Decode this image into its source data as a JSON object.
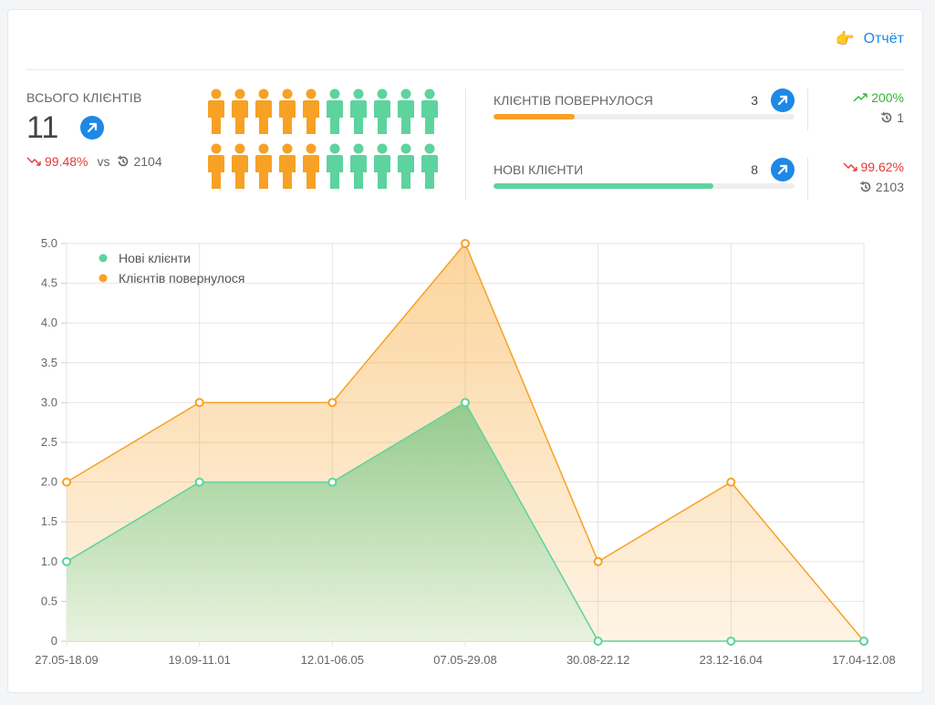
{
  "header": {
    "report_label": "Отчёт"
  },
  "summary": {
    "total_label": "ВСЬОГО КЛІЄНТІВ",
    "total_value": "11",
    "change_pct": "99.48%",
    "vs_label": "vs",
    "previous_value": "2104"
  },
  "people_grid": {
    "total": 20,
    "returned": 5,
    "colors": {
      "returned": "#f7a125",
      "new": "#5dd39e"
    }
  },
  "metrics": [
    {
      "label": "КЛІЄНТІВ ПОВЕРНУЛОСЯ",
      "value": "3",
      "fill_fraction": 0.27,
      "color": "#f7a125",
      "change_pct": "200%",
      "change_dir": "up",
      "previous_value": "1"
    },
    {
      "label": "НОВІ КЛІЄНТИ",
      "value": "8",
      "fill_fraction": 0.73,
      "color": "#5dd39e",
      "change_pct": "99.62%",
      "change_dir": "down",
      "previous_value": "2103"
    }
  ],
  "colors": {
    "accent": "#1e88e5",
    "down": "#e53935",
    "up": "#2eb82e",
    "orange": "#f7a125",
    "green": "#5dd39e"
  },
  "chart_data": {
    "type": "area",
    "categories": [
      "27.05-18.09",
      "19.09-11.01",
      "12.01-06.05",
      "07.05-29.08",
      "30.08-22.12",
      "23.12-16.04",
      "17.04-12.08"
    ],
    "series": [
      {
        "name": "Нові клієнти",
        "values": [
          1,
          2,
          2,
          3,
          0,
          0,
          0
        ],
        "color": "#5dd39e"
      },
      {
        "name": "Клієнтів повернулося",
        "values": [
          2,
          3,
          3,
          5,
          1,
          2,
          0
        ],
        "color": "#f7a125"
      }
    ],
    "yticks": [
      "0",
      "0.5",
      "1.0",
      "1.5",
      "2.0",
      "2.5",
      "3.0",
      "3.5",
      "4.0",
      "4.5",
      "5.0"
    ],
    "ylim": [
      0,
      5
    ],
    "grid": true,
    "legend_position": "top-left"
  }
}
